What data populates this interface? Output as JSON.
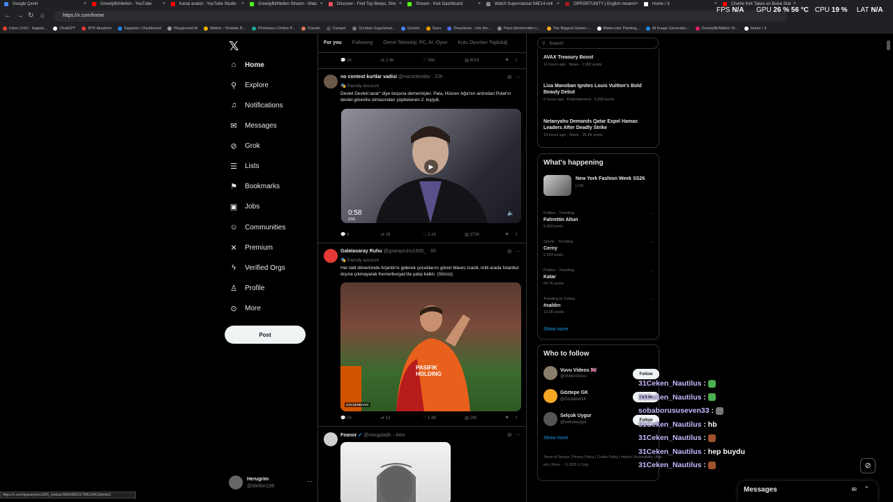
{
  "browser": {
    "tabs": [
      {
        "title": "Google Çeviri",
        "color": "#4285f4"
      },
      {
        "title": "GreedyBirMellon - YouTube",
        "color": "#ff0000"
      },
      {
        "title": "Kanal analizi - YouTube Studio",
        "color": "#ff0000"
      },
      {
        "title": "GreedyBirMellon Stream - Watc",
        "color": "#53fc18"
      },
      {
        "title": "Discover - Find Top Blerps, Stre",
        "color": "#ff4f64"
      },
      {
        "title": "Stream - Kick Dashboard",
        "color": "#53fc18"
      },
      {
        "title": "Watch Supernatural S6E14 onli",
        "color": "#888888"
      },
      {
        "title": "OPPORTUNITY | English meanin",
        "color": "#a31b1b"
      },
      {
        "title": "Home / X",
        "color": "#ffffff"
      },
      {
        "title": "Charlie Kirk Takes on Boise Stat",
        "color": "#ff0000"
      }
    ],
    "url": "https://x.com/home",
    "bookmarks": [
      {
        "label": "Inbox (142) - bagisis...",
        "color": "#ea4335"
      },
      {
        "label": "ChatGPT",
        "color": "#ffffff"
      },
      {
        "label": "BTK Akademi",
        "color": "#e53935"
      },
      {
        "label": "Sapphire | Dashboard",
        "color": "#1e88e5"
      },
      {
        "label": "Playground AI",
        "color": "#999999"
      },
      {
        "label": "Mellon - Youtube B...",
        "color": "#f4b400"
      },
      {
        "label": "Photopea | Online P...",
        "color": "#18a497"
      },
      {
        "label": "Claude",
        "color": "#d97757"
      },
      {
        "label": "Camper",
        "color": "#555555"
      },
      {
        "label": "Ücretsiz Uygulamal...",
        "color": "#777777"
      },
      {
        "label": "Gemini",
        "color": "#4285f4"
      },
      {
        "label": "Suno",
        "color": "#f4a100"
      },
      {
        "label": "DeepSeek - Into the...",
        "color": "#4d6bfe"
      },
      {
        "label": "Pano (bentrendim.c...",
        "color": "#888888"
      },
      {
        "label": "The Biggest Gamer-...",
        "color": "#f9a825"
      },
      {
        "label": "Watercolor Painting...",
        "color": "#ffffff"
      },
      {
        "label": "AI Image Generator...",
        "color": "#1e88e5"
      },
      {
        "label": "GreedyBirMellon St...",
        "color": "#e91e63"
      },
      {
        "label": "Home / X",
        "color": "#ffffff"
      }
    ],
    "status_url": "https://x.com/gsarayruhu1905_/status/1966090031799611841/photo/1"
  },
  "hud": {
    "fps_label": "FPS",
    "fps_value": "N/A",
    "gpu_label": "GPU",
    "gpu_value": "26 % 56 °C",
    "cpu_label": "CPU",
    "cpu_value": "19 %",
    "lat_label": "LAT",
    "lat_value": "N/A"
  },
  "nav": {
    "logo": "𝕏",
    "items": [
      {
        "label": "Home",
        "icon": "home-icon",
        "glyph": "⌂"
      },
      {
        "label": "Explore",
        "icon": "search-icon",
        "glyph": "⚲"
      },
      {
        "label": "Notifications",
        "icon": "bell-icon",
        "glyph": "♫"
      },
      {
        "label": "Messages",
        "icon": "envelope-icon",
        "glyph": "✉"
      },
      {
        "label": "Grok",
        "icon": "grok-icon",
        "glyph": "⊘"
      },
      {
        "label": "Lists",
        "icon": "list-icon",
        "glyph": "☰"
      },
      {
        "label": "Bookmarks",
        "icon": "bookmark-icon",
        "glyph": "⚑"
      },
      {
        "label": "Jobs",
        "icon": "briefcase-icon",
        "glyph": "▣"
      },
      {
        "label": "Communities",
        "icon": "people-icon",
        "glyph": "☺"
      },
      {
        "label": "Premium",
        "icon": "x-icon",
        "glyph": "✕"
      },
      {
        "label": "Verified Orgs",
        "icon": "lightning-icon",
        "glyph": "ϟ"
      },
      {
        "label": "Profile",
        "icon": "person-icon",
        "glyph": "♙"
      },
      {
        "label": "More",
        "icon": "more-circle-icon",
        "glyph": "⊙"
      }
    ],
    "post_label": "Post",
    "account": {
      "name": "Herugrim",
      "handle": "@Mellon199",
      "more": "···"
    }
  },
  "feed": {
    "tabs": [
      "For you",
      "Following",
      "Genel Teknoloji, PC, AI, Oyun",
      "Kutu Oyunları Topluluğ"
    ],
    "top_actions": {
      "reply": "1K",
      "repost": "2.4K",
      "like": "26K",
      "views": "801K"
    },
    "tweets": [
      {
        "name": "no context kurtlar vadisi",
        "handle": "@nocontextklv",
        "time": "· 22h",
        "parody": "Parody account",
        "text": "Devlet Devleti tarar\" diye boşuna dememişler. Pala, Hüsrev Ağa'nın ardından Polat'ın devlet görevlisi olmasından şüphelenen 2. kişiydi.",
        "video_time": "0:58",
        "video_time_small": "0:58",
        "reply": "4",
        "repost": "28",
        "like": "2.1K",
        "views": "373K"
      },
      {
        "name": "Galatasaray Ruhu",
        "handle": "@gsarayruhu1905_",
        "time": "· 6h",
        "parody": "Parody account",
        "text": "Her tatil döneminde Arjantin'e giderek çocuklarını gören Mauro Icardi, milli arada İstanbul dışına çıkmayarak Kemerburgaz'da yatıp kalktı. (Sözcü)",
        "watermark": "GOLDENBAHIS",
        "jersey_text": "PASIFIK\nHOLDING",
        "reply": "24",
        "repost": "13",
        "like": "1.4K",
        "views": "29K"
      },
      {
        "name": "Feanor",
        "handle": "@nimgaladh",
        "time": "· 44m"
      }
    ]
  },
  "sidebar": {
    "search_placeholder": "Search",
    "news": [
      {
        "title": "AVAX Treasury Boost",
        "meta": "11 hours ago · News · 1,992 posts"
      },
      {
        "title": "Lisa Manoban Ignites Louis Vuitton's Bold Beauty Debut",
        "meta": "6 hours ago · Entertainment · 5,930 posts"
      },
      {
        "title": "Netanyahu Demands Qatar Expel Hamas Leaders After Deadly Strike",
        "meta": "13 hours ago · News · 26.2K posts"
      }
    ],
    "happening_title": "What's happening",
    "event": {
      "title": "New York Fashion Week SS26",
      "status": "LIVE"
    },
    "trends": [
      {
        "cat": "Politics · Trending",
        "name": "Fahrettin Altun",
        "posts": "6,443 posts"
      },
      {
        "cat": "Sports · Trending",
        "name": "Cerny",
        "posts": "2,524 posts"
      },
      {
        "cat": "Politics · Trending",
        "name": "Katar",
        "posts": "64.7K posts"
      },
      {
        "cat": "Trending in Turkey",
        "name": "#saldırı",
        "posts": "13.2K posts"
      }
    ],
    "show_more": "Show more",
    "who_title": "Who to follow",
    "who": [
      {
        "name": "Vuvu Videos 🇬🇧",
        "handle": "@VideosVuvu",
        "follow": "Follow",
        "color": "#8a7e6a"
      },
      {
        "name": "Göztepe GK",
        "handle": "@GoztepeGK",
        "follow": "Follow",
        "color": "#f5a623"
      },
      {
        "name": "Selçuk Uygur",
        "handle": "@selcukuygur",
        "follow": "Follow",
        "color": "#555555"
      }
    ],
    "footer": "Terms of Service | Privacy Policy | Cookie Policy | Imprint | Accessibility | Ads info | More ··· © 2025 X Corp."
  },
  "chat": [
    {
      "user": "31Ceken_Nautilus",
      "msg": ":",
      "emote": "#4caf50"
    },
    {
      "user": "31Ceken_Nautilus",
      "msg": ":",
      "emote": "#4caf50"
    },
    {
      "user": "sobaborususeven33",
      "msg": ":",
      "emote": "#777777"
    },
    {
      "user": "31Ceken_Nautilus",
      "msg": ": hb",
      "emote": ""
    },
    {
      "user": "31Ceken_Nautilus",
      "msg": ":",
      "emote": "#a0522d"
    },
    {
      "user": "31Ceken_Nautilus",
      "msg": ": hep buydu",
      "emote": ""
    },
    {
      "user": "31Ceken_Nautilus",
      "msg": ":",
      "emote": "#a0522d"
    }
  ],
  "messages_bar": {
    "title": "Messages"
  }
}
